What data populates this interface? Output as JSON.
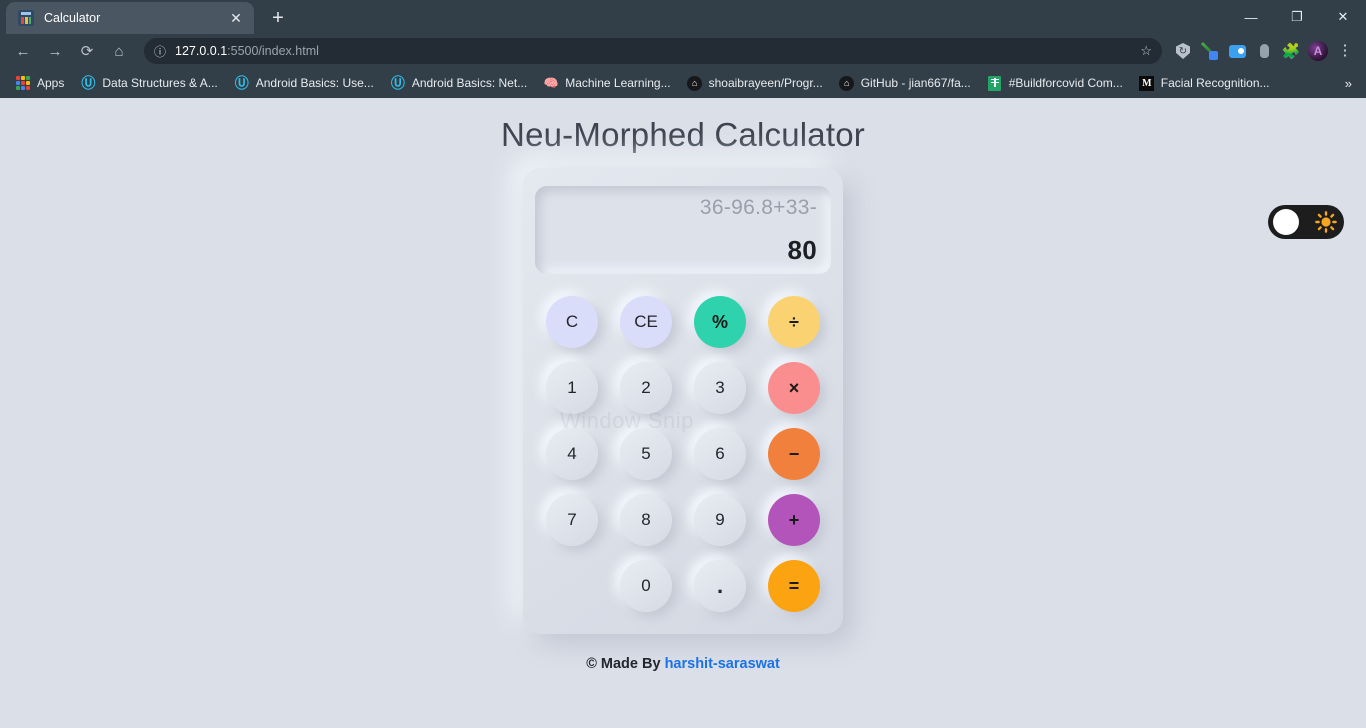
{
  "browser": {
    "tab": {
      "title": "Calculator",
      "favicon": "calculator-icon",
      "close_label": "✕"
    },
    "new_tab_label": "+",
    "window_controls": {
      "minimize": "—",
      "maximize": "❐",
      "close": "✕"
    },
    "nav": {
      "back": "←",
      "forward": "→",
      "reload": "⟳",
      "home": "⌂"
    },
    "omnibox": {
      "info_icon": "ⓘ",
      "host": "127.0.0.1",
      "path": ":5500/index.html",
      "full_url": "127.0.0.1:5500/index.html",
      "star_icon": "☆"
    },
    "toolbar_icons": [
      {
        "name": "shield-icon",
        "glyph": ""
      },
      {
        "name": "eyedropper-icon",
        "glyph": ""
      },
      {
        "name": "zoom-video-icon",
        "glyph": ""
      },
      {
        "name": "bug-icon",
        "glyph": ""
      },
      {
        "name": "extensions-puzzle-icon",
        "glyph": "🧩"
      },
      {
        "name": "profile-avatar-icon",
        "glyph": "A"
      },
      {
        "name": "chrome-menu-icon",
        "glyph": "⋮"
      }
    ],
    "bookmarks": [
      {
        "label": "Apps",
        "icon": "apps-grid-icon"
      },
      {
        "label": "Data Structures & A...",
        "icon": "udacity-icon"
      },
      {
        "label": "Android Basics: Use...",
        "icon": "udacity-icon"
      },
      {
        "label": "Android Basics: Net...",
        "icon": "udacity-icon"
      },
      {
        "label": "Machine Learning...",
        "icon": "brain-icon"
      },
      {
        "label": "shoaibrayeen/Progr...",
        "icon": "github-icon"
      },
      {
        "label": "GitHub - jian667/fa...",
        "icon": "github-icon"
      },
      {
        "label": "#Buildforcovid Com...",
        "icon": "google-sheets-icon"
      },
      {
        "label": "Facial Recognition...",
        "icon": "medium-icon"
      }
    ],
    "bookmarks_overflow": "»"
  },
  "app": {
    "title": "Neu-Morphed Calculator",
    "theme_toggle": {
      "name": "theme-toggle",
      "state": "light",
      "icon": "sun-icon"
    },
    "display": {
      "expression": "36-96.8+33-",
      "result": "80"
    },
    "keys": [
      {
        "label": "C",
        "name": "key-clear-all",
        "style": "clear"
      },
      {
        "label": "CE",
        "name": "key-clear-entry",
        "style": "clear"
      },
      {
        "label": "%",
        "name": "key-percent",
        "style": "pct"
      },
      {
        "label": "÷",
        "name": "key-divide",
        "style": "div"
      },
      {
        "label": "1",
        "name": "key-1",
        "style": "num"
      },
      {
        "label": "2",
        "name": "key-2",
        "style": "num"
      },
      {
        "label": "3",
        "name": "key-3",
        "style": "num"
      },
      {
        "label": "×",
        "name": "key-multiply",
        "style": "mul"
      },
      {
        "label": "4",
        "name": "key-4",
        "style": "num"
      },
      {
        "label": "5",
        "name": "key-5",
        "style": "num"
      },
      {
        "label": "6",
        "name": "key-6",
        "style": "num"
      },
      {
        "label": "−",
        "name": "key-subtract",
        "style": "sub"
      },
      {
        "label": "7",
        "name": "key-7",
        "style": "num"
      },
      {
        "label": "8",
        "name": "key-8",
        "style": "num"
      },
      {
        "label": "9",
        "name": "key-9",
        "style": "num"
      },
      {
        "label": "+",
        "name": "key-add",
        "style": "add"
      },
      {
        "label": "",
        "name": "key-spacer",
        "style": "blank"
      },
      {
        "label": "0",
        "name": "key-0",
        "style": "num"
      },
      {
        "label": ".",
        "name": "key-decimal",
        "style": "dot"
      },
      {
        "label": "=",
        "name": "key-equals",
        "style": "eq"
      }
    ],
    "footer": {
      "prefix": "© Made By ",
      "author": "harshit-saraswat"
    },
    "watermark": "Window Snip"
  },
  "colors": {
    "page_bg": "#dbdfe8",
    "clear": "#d9ddfa",
    "percent": "#2ed2ac",
    "divide": "#fbd271",
    "multiply": "#fa8d8d",
    "subtract": "#f0803c",
    "add": "#b254b9",
    "equals": "#fca311",
    "link": "#1a73e8",
    "chrome_bg": "#323e48"
  }
}
